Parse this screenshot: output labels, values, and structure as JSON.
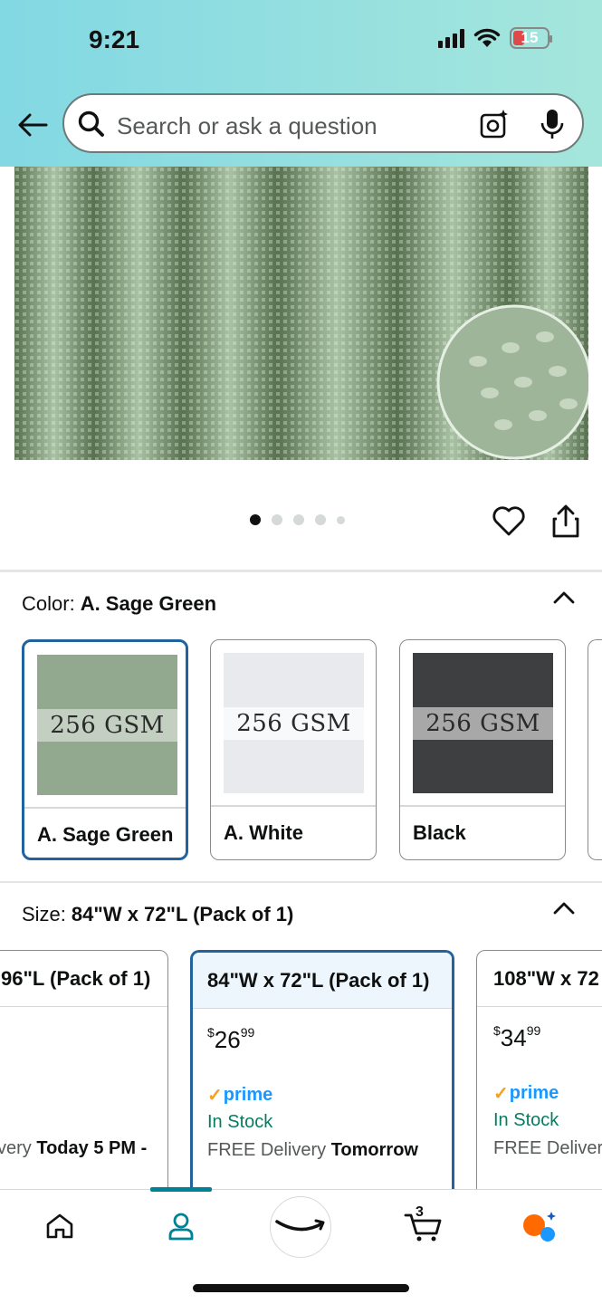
{
  "status_bar": {
    "time": "9:21",
    "battery": "15"
  },
  "search": {
    "placeholder": "Search or ask a question"
  },
  "gallery": {
    "image_count": 5,
    "active_index": 0
  },
  "color": {
    "label": "Color:",
    "selected": "A. Sage Green",
    "swatches": [
      {
        "label": "A. Sage Green",
        "overlay_text": "256 GSM",
        "tone": "#93a98f",
        "selected": true
      },
      {
        "label": "A. White",
        "overlay_text": "256 GSM",
        "tone": "#e8eaed",
        "selected": false
      },
      {
        "label": "Black",
        "overlay_text": "256 GSM",
        "tone": "#3e3f41",
        "selected": false
      }
    ]
  },
  "size": {
    "label": "Size:",
    "selected": "84\"W x 72\"L (Pack of 1)",
    "options": [
      {
        "title": "96\"L (Pack of 1)",
        "delivery_prefix": "very",
        "delivery_bold": "Today 5 PM -"
      },
      {
        "title": "84\"W x 72\"L (Pack of 1)",
        "price_symbol": "$",
        "price_whole": "26",
        "price_fraction": "99",
        "prime": "prime",
        "stock": "In Stock",
        "delivery_prefix": "FREE Delivery",
        "delivery_bold": "Tomorrow",
        "selected": true
      },
      {
        "title": "108\"W x 72",
        "price_symbol": "$",
        "price_whole": "34",
        "price_fraction": "99",
        "prime": "prime",
        "stock": "In Stock",
        "delivery_prefix": "FREE Delivery"
      }
    ]
  },
  "bottom_nav": {
    "items": [
      "home-icon",
      "account-icon",
      "amazon-smile-icon",
      "cart-icon",
      "rufus-icon"
    ],
    "cart_count": "3",
    "active": "account-icon"
  },
  "colors": {
    "accent_blue": "#2162a1",
    "prime_blue": "#1a98ff",
    "stock_green": "#067d62",
    "nav_teal": "#008296"
  }
}
